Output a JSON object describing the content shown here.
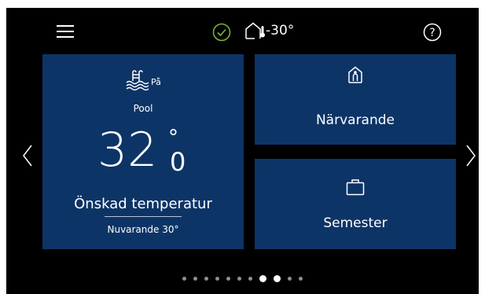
{
  "header": {
    "menu_icon": "hamburger-menu-icon",
    "status_icon": "check-circle-icon",
    "status_color": "#7fb838",
    "outdoor_icon": "house-thermometer-icon",
    "outdoor_temperature": "-30°",
    "help_icon": "question-circle-icon"
  },
  "pool_tile": {
    "icon": "pool-icon",
    "state": "På",
    "name": "Pool",
    "temperature_value": "32",
    "temperature_degree": "°",
    "temperature_decimal": "0",
    "desired_label": "Önskad temperatur",
    "current_label": "Nuvarande 30°"
  },
  "home_tile": {
    "icon": "person-home-icon",
    "label": "Närvarande"
  },
  "vacation_tile": {
    "icon": "suitcase-icon",
    "label": "Semester"
  },
  "navigation": {
    "left_icon": "chevron-left-icon",
    "right_icon": "chevron-right-icon"
  },
  "pager": {
    "total": 11,
    "active_index": 7,
    "secondary_index": 8
  },
  "colors": {
    "tile_background": "#0d3466",
    "screen_background": "#000000",
    "dot_inactive": "#8f8f8f",
    "dot_active": "#ffffff"
  }
}
